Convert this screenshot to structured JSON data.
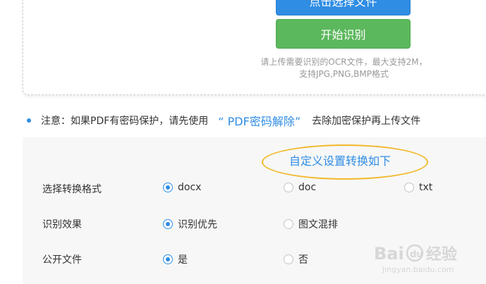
{
  "upload": {
    "select_button": "点击选择文件",
    "start_button": "开始识别",
    "hint_line1": "请上传需要识别的OCR文件，最大支持2M，",
    "hint_line2": "支持JPG,PNG,BMP格式"
  },
  "notice": {
    "prefix": "注意：如果PDF有密码保护，请先使用",
    "link": "“ PDF密码解除”",
    "suffix": "去除加密保护再上传文件"
  },
  "settings": {
    "title": "自定义设置转换如下",
    "rows": [
      {
        "label": "选择转换格式",
        "options": [
          {
            "label": "docx",
            "selected": true
          },
          {
            "label": "doc",
            "selected": false
          },
          {
            "label": "txt",
            "selected": false
          }
        ]
      },
      {
        "label": "识别效果",
        "options": [
          {
            "label": "识别优先",
            "selected": true
          },
          {
            "label": "图文混排",
            "selected": false
          }
        ]
      },
      {
        "label": "公开文件",
        "options": [
          {
            "label": "是",
            "selected": true
          },
          {
            "label": "否",
            "selected": false
          }
        ]
      }
    ]
  },
  "watermark": {
    "brand": "Bai",
    "brand_cn": "经验",
    "url": "jingyan.baidu.com"
  },
  "colors": {
    "accent_blue": "#2f8de4",
    "start_green": "#5cb85c",
    "highlight_oval": "#f2b82a"
  }
}
